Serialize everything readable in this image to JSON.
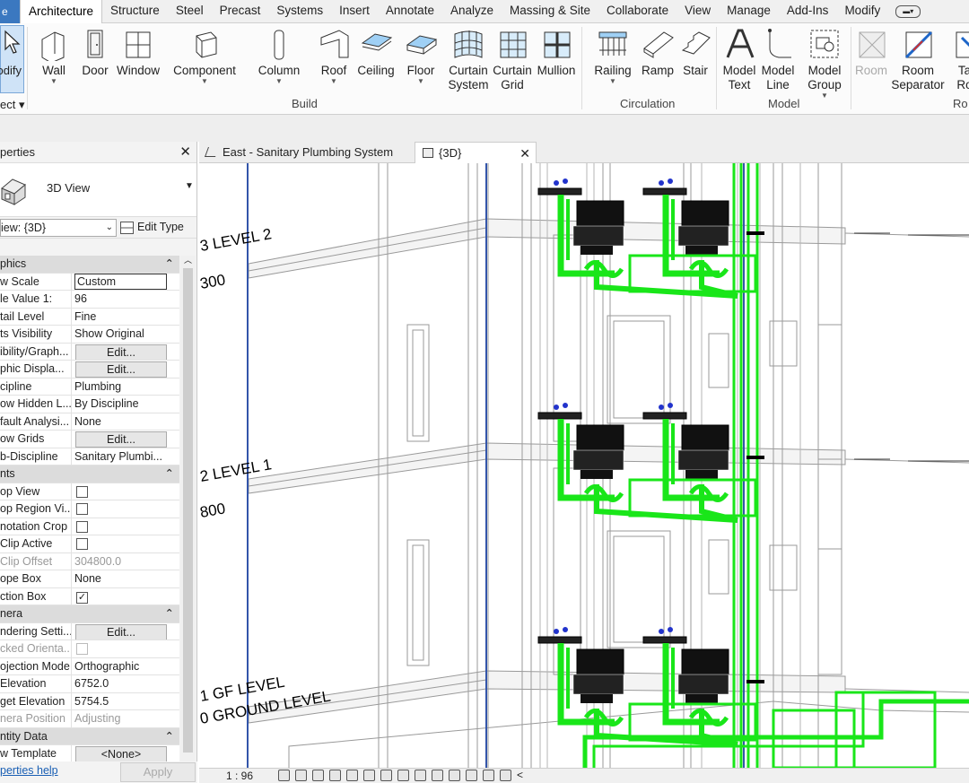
{
  "menu": {
    "file_label": "e",
    "tabs": [
      "Architecture",
      "Structure",
      "Steel",
      "Precast",
      "Systems",
      "Insert",
      "Annotate",
      "Analyze",
      "Massing & Site",
      "Collaborate",
      "View",
      "Manage",
      "Add-Ins",
      "Modify"
    ],
    "active_tab": "Architecture",
    "extra_icon": "video-icon"
  },
  "ribbon": {
    "modify_label": "odify",
    "select_label": "ect",
    "buttons": [
      {
        "id": "wall",
        "line1": "Wall",
        "line2": "",
        "dropdown": true,
        "icon": "wall-icon"
      },
      {
        "id": "door",
        "line1": "Door",
        "line2": "",
        "dropdown": false,
        "icon": "door-icon"
      },
      {
        "id": "window",
        "line1": "Window",
        "line2": "",
        "dropdown": false,
        "icon": "window-icon"
      },
      {
        "id": "component",
        "line1": "Component",
        "line2": "",
        "dropdown": true,
        "icon": "component-icon"
      },
      {
        "id": "column",
        "line1": "Column",
        "line2": "",
        "dropdown": true,
        "icon": "column-icon"
      },
      {
        "id": "roof",
        "line1": "Roof",
        "line2": "",
        "dropdown": true,
        "icon": "roof-icon"
      },
      {
        "id": "ceiling",
        "line1": "Ceiling",
        "line2": "",
        "dropdown": false,
        "icon": "ceiling-icon"
      },
      {
        "id": "floor",
        "line1": "Floor",
        "line2": "",
        "dropdown": true,
        "icon": "floor-icon"
      },
      {
        "id": "curtain_system",
        "line1": "Curtain",
        "line2": "System",
        "dropdown": false,
        "icon": "curtain-system-icon"
      },
      {
        "id": "curtain_grid",
        "line1": "Curtain",
        "line2": "Grid",
        "dropdown": false,
        "icon": "curtain-grid-icon"
      },
      {
        "id": "mullion",
        "line1": "Mullion",
        "line2": "",
        "dropdown": false,
        "icon": "mullion-icon"
      },
      {
        "id": "railing",
        "line1": "Railing",
        "line2": "",
        "dropdown": true,
        "icon": "railing-icon"
      },
      {
        "id": "ramp",
        "line1": "Ramp",
        "line2": "",
        "dropdown": false,
        "icon": "ramp-icon"
      },
      {
        "id": "stair",
        "line1": "Stair",
        "line2": "",
        "dropdown": false,
        "icon": "stair-icon"
      },
      {
        "id": "model_text",
        "line1": "Model",
        "line2": "Text",
        "dropdown": false,
        "icon": "model-text-icon"
      },
      {
        "id": "model_line",
        "line1": "Model",
        "line2": "Line",
        "dropdown": false,
        "icon": "model-line-icon"
      },
      {
        "id": "model_group",
        "line1": "Model",
        "line2": "Group",
        "dropdown": true,
        "icon": "model-group-icon"
      },
      {
        "id": "room",
        "line1": "Room",
        "line2": "",
        "dropdown": false,
        "icon": "room-icon",
        "disabled": true
      },
      {
        "id": "room_separator",
        "line1": "Room",
        "line2": "Separator",
        "dropdown": false,
        "icon": "room-separator-icon"
      },
      {
        "id": "tag_room",
        "line1": "Ta",
        "line2": "Ro",
        "dropdown": false,
        "icon": "tag-room-icon"
      }
    ],
    "panels": {
      "build": "Build",
      "circulation": "Circulation",
      "model": "Model",
      "room": "Ro"
    }
  },
  "properties": {
    "title": "perties",
    "type_name": "3D View",
    "view_selector": "iew: {3D}",
    "edit_type": "Edit Type",
    "rows": [
      {
        "kind": "section",
        "label": "phics"
      },
      {
        "label": "w Scale",
        "value": "Custom",
        "style": "box"
      },
      {
        "label": "le Value    1:",
        "value": "96"
      },
      {
        "label": "tail Level",
        "value": "Fine"
      },
      {
        "label": "ts Visibility",
        "value": "Show Original"
      },
      {
        "label": "ibility/Graph...",
        "value": "Edit...",
        "style": "button"
      },
      {
        "label": "phic Displa...",
        "value": "Edit...",
        "style": "button"
      },
      {
        "label": "cipline",
        "value": "Plumbing"
      },
      {
        "label": "ow Hidden L...",
        "value": "By Discipline"
      },
      {
        "label": "fault Analysi...",
        "value": "None"
      },
      {
        "label": "ow Grids",
        "value": "Edit...",
        "style": "button"
      },
      {
        "label": "b-Discipline",
        "value": "Sanitary Plumbi..."
      },
      {
        "kind": "section",
        "label": "nts"
      },
      {
        "label": "op View",
        "value": "",
        "style": "check",
        "checked": false
      },
      {
        "label": "op Region Vi...",
        "value": "",
        "style": "check",
        "checked": false
      },
      {
        "label": "notation Crop",
        "value": "",
        "style": "check",
        "checked": false
      },
      {
        "label": "Clip Active",
        "value": "",
        "style": "check",
        "checked": false
      },
      {
        "label": "Clip Offset",
        "value": "304800.0",
        "grey": true
      },
      {
        "label": "ope Box",
        "value": "None"
      },
      {
        "label": "ction Box",
        "value": "",
        "style": "check",
        "checked": true
      },
      {
        "kind": "section",
        "label": "nera"
      },
      {
        "label": "ndering Setti...",
        "value": "Edit...",
        "style": "button"
      },
      {
        "label": "cked Orienta...",
        "value": "",
        "style": "check",
        "checked": false,
        "grey": true
      },
      {
        "label": "ojection Mode",
        "value": "Orthographic"
      },
      {
        "label": "Elevation",
        "value": "6752.0"
      },
      {
        "label": "get Elevation",
        "value": "5754.5"
      },
      {
        "label": "nera Position",
        "value": "Adjusting",
        "grey": true
      },
      {
        "kind": "section",
        "label": "ntity Data"
      },
      {
        "label": "w Template",
        "value": "<None>",
        "style": "button"
      }
    ],
    "help_link": "perties help",
    "apply": "Apply"
  },
  "tabs": [
    {
      "label": "East - Sanitary Plumbing System",
      "icon": "elevation-view-icon",
      "active": false
    },
    {
      "label": "{3D}",
      "icon": "3d-view-icon",
      "active": true
    }
  ],
  "viewport": {
    "levels": [
      {
        "name": "3 LEVEL 2",
        "elev": "300"
      },
      {
        "name": "2 LEVEL 1",
        "elev": "800"
      },
      {
        "name": "1 GF LEVEL",
        "elev": "0 GROUND LEVEL"
      }
    ],
    "pipe_color": "#19e619"
  },
  "status": {
    "scale": "1 : 96"
  }
}
